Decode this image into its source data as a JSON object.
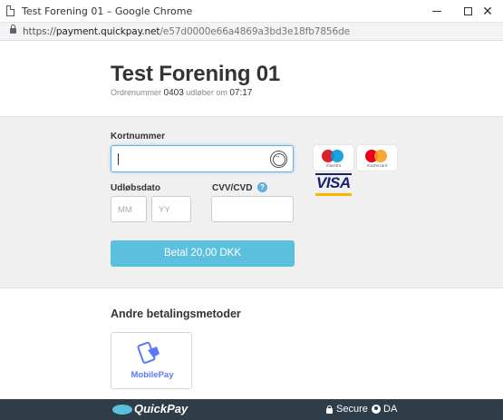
{
  "window": {
    "title": "Test Forening 01 – Google Chrome",
    "minimize_icon": "minimize-icon",
    "maximize_icon": "maximize-icon",
    "close_icon": "close-icon"
  },
  "address_bar": {
    "protocol": "https://",
    "host": "payment.quickpay.net",
    "path": "/e57d0000e66a4869a3bd3e18fb7856de",
    "lock_icon": "lock-icon"
  },
  "header": {
    "title": "Test Forening 01",
    "order_label": "Ordrenummer",
    "order_number": "0403",
    "expires_label": "udløber om",
    "expires_time": "07:17"
  },
  "card_form": {
    "card_number_label": "Kortnummer",
    "card_number_value": "",
    "expiry_label": "Udløbsdato",
    "month_placeholder": "MM",
    "year_placeholder": "YY",
    "cvv_label": "CVV/CVD",
    "cvv_value": "",
    "help_icon_text": "?",
    "pay_button_label": "Betal 20,00 DKK"
  },
  "brands": [
    {
      "name": "maestro",
      "colors": [
        "#d9222a",
        "#0099df"
      ]
    },
    {
      "name": "mastercard",
      "colors": [
        "#eb001b",
        "#f79e1b"
      ]
    },
    {
      "name": "VISA",
      "colors": [
        "#1a1f71",
        "#f7b600"
      ]
    }
  ],
  "alternative_methods": {
    "title": "Andre betalingsmetoder",
    "items": [
      {
        "label": "MobilePay",
        "icon": "mobilepay-icon",
        "color": "#5a78ff"
      }
    ]
  },
  "footer": {
    "brand": "QuickPay",
    "secure_label": "Secure",
    "language": "DA"
  },
  "colors": {
    "accent": "#5bc0de",
    "footer_bg": "#2e3d48",
    "section_bg": "#f0f0f0"
  }
}
